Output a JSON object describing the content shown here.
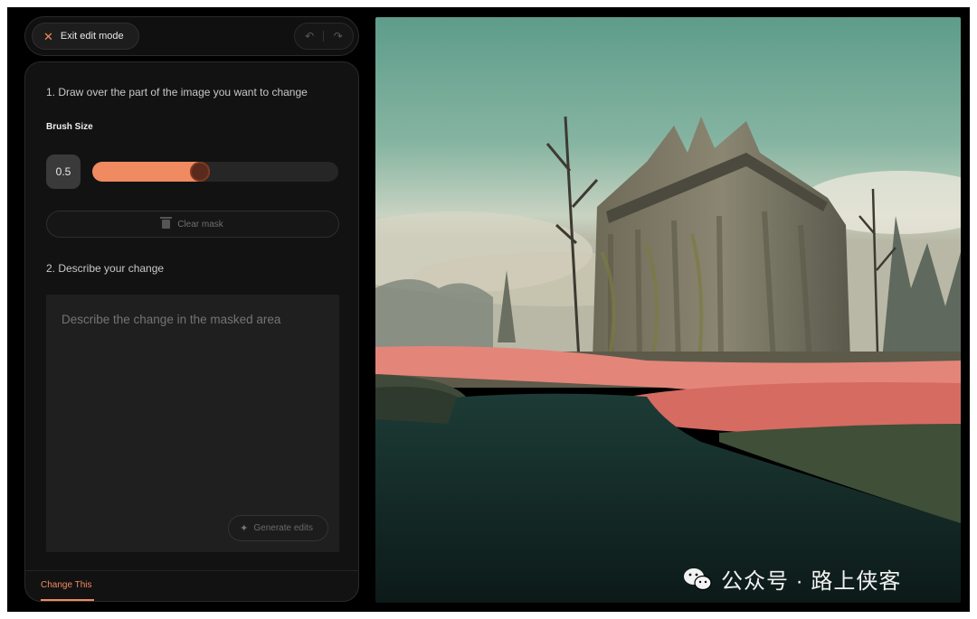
{
  "topbar": {
    "exit_label": "Exit edit mode",
    "undo_icon": "undo-icon",
    "redo_icon": "redo-icon"
  },
  "panel": {
    "step1": "1. Draw over the part of the image you want to change",
    "brush_label": "Brush Size",
    "brush_value": "0.5",
    "brush_slider_level": 0.43,
    "clear_label": "Clear mask",
    "step2": "2. Describe your change",
    "describe_placeholder": "Describe the change in the masked area",
    "generate_label": "Generate edits",
    "tab_label": "Change This"
  },
  "colors": {
    "accent": "#f08a60",
    "background": "#000000",
    "panel": "#121212"
  },
  "watermark": {
    "text": "公众号 · 路上侠客"
  }
}
